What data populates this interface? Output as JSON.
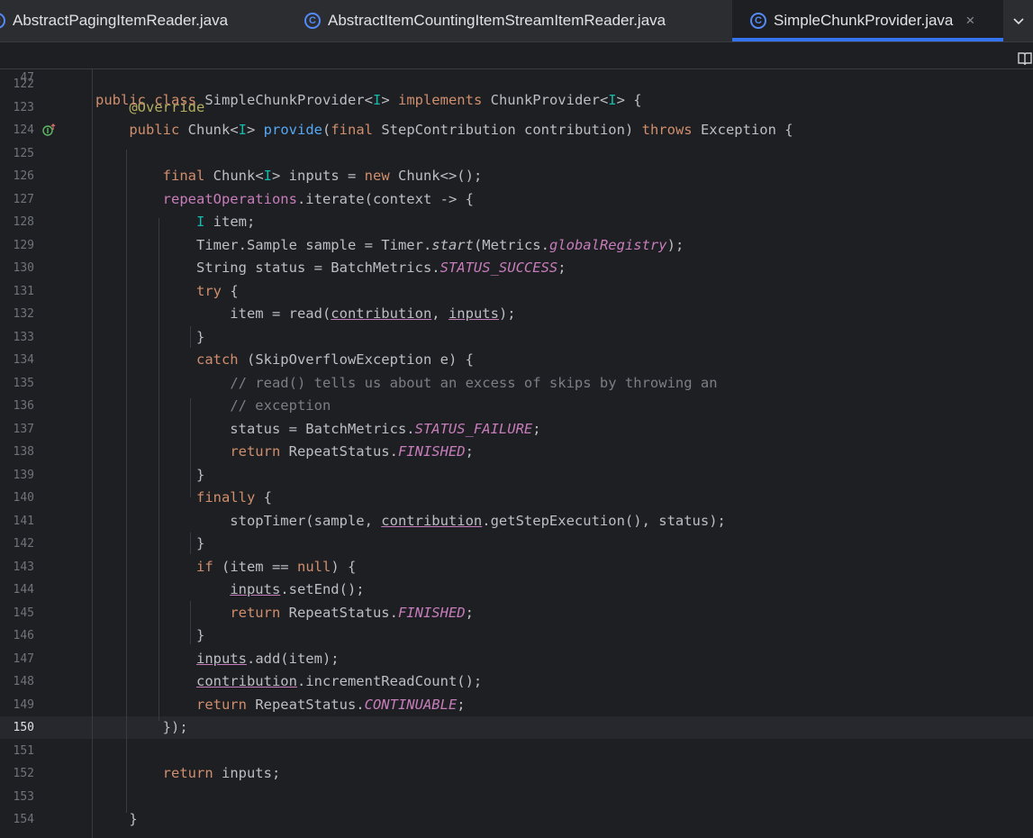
{
  "tabs": [
    {
      "label": "AbstractPagingItemReader.java",
      "active": false
    },
    {
      "label": "AbstractItemCountingItemStreamItemReader.java",
      "active": false
    },
    {
      "label": "SimpleChunkProvider.java",
      "active": true
    }
  ],
  "tab_icon_letter": "C",
  "close_glyph": "×",
  "sticky": {
    "line_number": "47",
    "tokens": [
      {
        "t": "public class ",
        "c": "kw"
      },
      {
        "t": "SimpleChunkProvider<"
      },
      {
        "t": "I",
        "c": "tp"
      },
      {
        "t": "> "
      },
      {
        "t": "implements ",
        "c": "kw"
      },
      {
        "t": "ChunkProvider<"
      },
      {
        "t": "I",
        "c": "tp"
      },
      {
        "t": "> {"
      }
    ]
  },
  "lines": [
    {
      "n": "122",
      "tokens": []
    },
    {
      "n": "123",
      "tokens": [
        {
          "t": "    "
        },
        {
          "t": "@Override",
          "c": "ann"
        }
      ]
    },
    {
      "n": "124",
      "tokens": [
        {
          "t": "    "
        },
        {
          "t": "public ",
          "c": "kw"
        },
        {
          "t": "Chunk<"
        },
        {
          "t": "I",
          "c": "tp"
        },
        {
          "t": "> "
        },
        {
          "t": "provide",
          "c": "fn"
        },
        {
          "t": "("
        },
        {
          "t": "final ",
          "c": "kw"
        },
        {
          "t": "StepContribution contribution) "
        },
        {
          "t": "throws ",
          "c": "kw"
        },
        {
          "t": "Exception {"
        }
      ]
    },
    {
      "n": "125",
      "tokens": []
    },
    {
      "n": "126",
      "tokens": [
        {
          "t": "        "
        },
        {
          "t": "final ",
          "c": "kw"
        },
        {
          "t": "Chunk<"
        },
        {
          "t": "I",
          "c": "tp"
        },
        {
          "t": "> inputs = "
        },
        {
          "t": "new ",
          "c": "kw"
        },
        {
          "t": "Chunk<>();"
        }
      ]
    },
    {
      "n": "127",
      "tokens": [
        {
          "t": "        "
        },
        {
          "t": "repeatOperations",
          "c": "fld-plain"
        },
        {
          "t": ".iterate(context -> {"
        }
      ]
    },
    {
      "n": "128",
      "tokens": [
        {
          "t": "            "
        },
        {
          "t": "I",
          "c": "tp"
        },
        {
          "t": " item;"
        }
      ]
    },
    {
      "n": "129",
      "tokens": [
        {
          "t": "            Timer.Sample sample = Timer."
        },
        {
          "t": "start",
          "c": "mth"
        },
        {
          "t": "(Metrics."
        },
        {
          "t": "globalRegistry",
          "c": "fld"
        },
        {
          "t": ");"
        }
      ]
    },
    {
      "n": "130",
      "tokens": [
        {
          "t": "            String status = BatchMetrics."
        },
        {
          "t": "STATUS_SUCCESS",
          "c": "fld"
        },
        {
          "t": ";"
        }
      ]
    },
    {
      "n": "131",
      "tokens": [
        {
          "t": "            "
        },
        {
          "t": "try ",
          "c": "kw"
        },
        {
          "t": "{"
        }
      ]
    },
    {
      "n": "132",
      "tokens": [
        {
          "t": "                item = read("
        },
        {
          "t": "contribution",
          "c": "ref"
        },
        {
          "t": ", "
        },
        {
          "t": "inputs",
          "c": "ref"
        },
        {
          "t": ");"
        }
      ]
    },
    {
      "n": "133",
      "tokens": [
        {
          "t": "            }"
        }
      ]
    },
    {
      "n": "134",
      "tokens": [
        {
          "t": "            "
        },
        {
          "t": "catch ",
          "c": "kw"
        },
        {
          "t": "(SkipOverflowException e) {"
        }
      ]
    },
    {
      "n": "135",
      "tokens": [
        {
          "t": "                "
        },
        {
          "t": "// read() tells us about an excess of skips by throwing an",
          "c": "cmt"
        }
      ]
    },
    {
      "n": "136",
      "tokens": [
        {
          "t": "                "
        },
        {
          "t": "// exception",
          "c": "cmt"
        }
      ]
    },
    {
      "n": "137",
      "tokens": [
        {
          "t": "                status = BatchMetrics."
        },
        {
          "t": "STATUS_FAILURE",
          "c": "fld"
        },
        {
          "t": ";"
        }
      ]
    },
    {
      "n": "138",
      "tokens": [
        {
          "t": "                "
        },
        {
          "t": "return ",
          "c": "kw"
        },
        {
          "t": "RepeatStatus."
        },
        {
          "t": "FINISHED",
          "c": "fld"
        },
        {
          "t": ";"
        }
      ]
    },
    {
      "n": "139",
      "tokens": [
        {
          "t": "            }"
        }
      ]
    },
    {
      "n": "140",
      "tokens": [
        {
          "t": "            "
        },
        {
          "t": "finally ",
          "c": "kw"
        },
        {
          "t": "{"
        }
      ]
    },
    {
      "n": "141",
      "tokens": [
        {
          "t": "                stopTimer(sample, "
        },
        {
          "t": "contribution",
          "c": "ref"
        },
        {
          "t": ".getStepExecution(), status);"
        }
      ]
    },
    {
      "n": "142",
      "tokens": [
        {
          "t": "            }"
        }
      ]
    },
    {
      "n": "143",
      "tokens": [
        {
          "t": "            "
        },
        {
          "t": "if ",
          "c": "kw"
        },
        {
          "t": "(item == "
        },
        {
          "t": "null",
          "c": "kw"
        },
        {
          "t": ") {"
        }
      ]
    },
    {
      "n": "144",
      "tokens": [
        {
          "t": "                "
        },
        {
          "t": "inputs",
          "c": "ref"
        },
        {
          "t": ".setEnd();"
        }
      ]
    },
    {
      "n": "145",
      "tokens": [
        {
          "t": "                "
        },
        {
          "t": "return ",
          "c": "kw"
        },
        {
          "t": "RepeatStatus."
        },
        {
          "t": "FINISHED",
          "c": "fld"
        },
        {
          "t": ";"
        }
      ]
    },
    {
      "n": "146",
      "tokens": [
        {
          "t": "            }"
        }
      ]
    },
    {
      "n": "147",
      "tokens": [
        {
          "t": "            "
        },
        {
          "t": "inputs",
          "c": "ref"
        },
        {
          "t": ".add(item);"
        }
      ]
    },
    {
      "n": "148",
      "tokens": [
        {
          "t": "            "
        },
        {
          "t": "contribution",
          "c": "ref"
        },
        {
          "t": ".incrementReadCount();"
        }
      ]
    },
    {
      "n": "149",
      "tokens": [
        {
          "t": "            "
        },
        {
          "t": "return ",
          "c": "kw"
        },
        {
          "t": "RepeatStatus."
        },
        {
          "t": "CONTINUABLE",
          "c": "fld"
        },
        {
          "t": ";"
        }
      ]
    },
    {
      "n": "150",
      "tokens": [
        {
          "t": "        });"
        }
      ],
      "current": true
    },
    {
      "n": "151",
      "tokens": []
    },
    {
      "n": "152",
      "tokens": [
        {
          "t": "        "
        },
        {
          "t": "return ",
          "c": "kw"
        },
        {
          "t": "inputs;"
        }
      ]
    },
    {
      "n": "153",
      "tokens": []
    },
    {
      "n": "154",
      "tokens": [
        {
          "t": "    }"
        }
      ]
    }
  ]
}
